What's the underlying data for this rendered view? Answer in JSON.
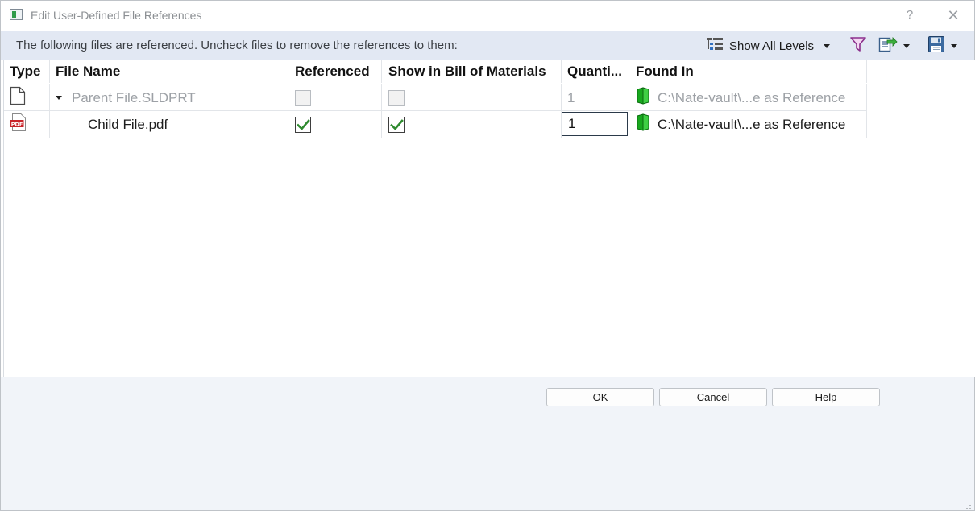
{
  "window": {
    "title": "Edit User-Defined File References",
    "help_label": "?",
    "close_label": "✕"
  },
  "infobar": {
    "message": "The following files are referenced. Uncheck files to remove the references to them:",
    "show_levels_label": "Show All Levels"
  },
  "grid": {
    "columns": [
      "Type",
      "File Name",
      "Referenced",
      "Show in Bill of Materials",
      "Quanti...",
      "Found In"
    ],
    "rows": [
      {
        "type_icon": "document-icon",
        "file_name": "Parent File.SLDPRT",
        "referenced": false,
        "show_in_bom": false,
        "quantity": "1",
        "found_in": "C:\\Nate-vault\\...e as Reference",
        "enabled": false
      },
      {
        "type_icon": "pdf-icon",
        "file_name": "Child File.pdf",
        "referenced": true,
        "show_in_bom": true,
        "quantity": "1",
        "found_in": "C:\\Nate-vault\\...e as Reference",
        "enabled": true
      }
    ]
  },
  "footer": {
    "ok_label": "OK",
    "cancel_label": "Cancel",
    "help_label": "Help"
  },
  "colors": {
    "infobar_bg": "#e2e8f3",
    "footer_bg": "#f1f4f9",
    "check_green": "#2e8a2e",
    "vault_green": "#18a81e",
    "pdf_red": "#c8242a"
  }
}
